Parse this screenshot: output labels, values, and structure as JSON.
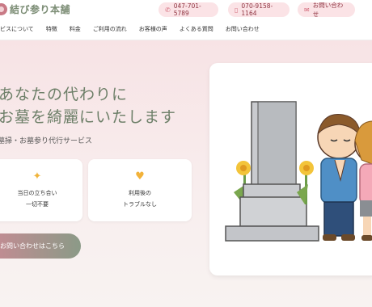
{
  "header": {
    "logo_text": "結び参り本舗",
    "contact": [
      {
        "label": "047-701-5789",
        "icon": "phone-icon"
      },
      {
        "label": "070-9158-1164",
        "icon": "mobile-phone-icon"
      },
      {
        "label": "お問い合わせ",
        "icon": "mail-icon"
      }
    ],
    "nav": [
      "サービスについて",
      "特徴",
      "料金",
      "ご利用の流れ",
      "お客様の声",
      "よくある質問",
      "お問い合わせ"
    ]
  },
  "hero": {
    "heading_line1": "あなたの代わりに",
    "heading_line2": "お墓を綺麗にいたします",
    "subheading": "墓掃・お墓参り代行サービス",
    "features": [
      {
        "icon": "sparkle-icon",
        "line1": "当日の立ち合い",
        "line2": "一切不要"
      },
      {
        "icon": "heart-hands-icon",
        "line1": "利用後の",
        "line2": "トラブルなし"
      }
    ],
    "cta_label": "お問い合わせはこちら",
    "illustration": "grave-with-praying-children"
  },
  "colors": {
    "accent_pink": "#fbe3e6",
    "brand_green": "#6d7f68",
    "cta_gradient_start": "#c98a94",
    "cta_gradient_end": "#8b9a87"
  }
}
